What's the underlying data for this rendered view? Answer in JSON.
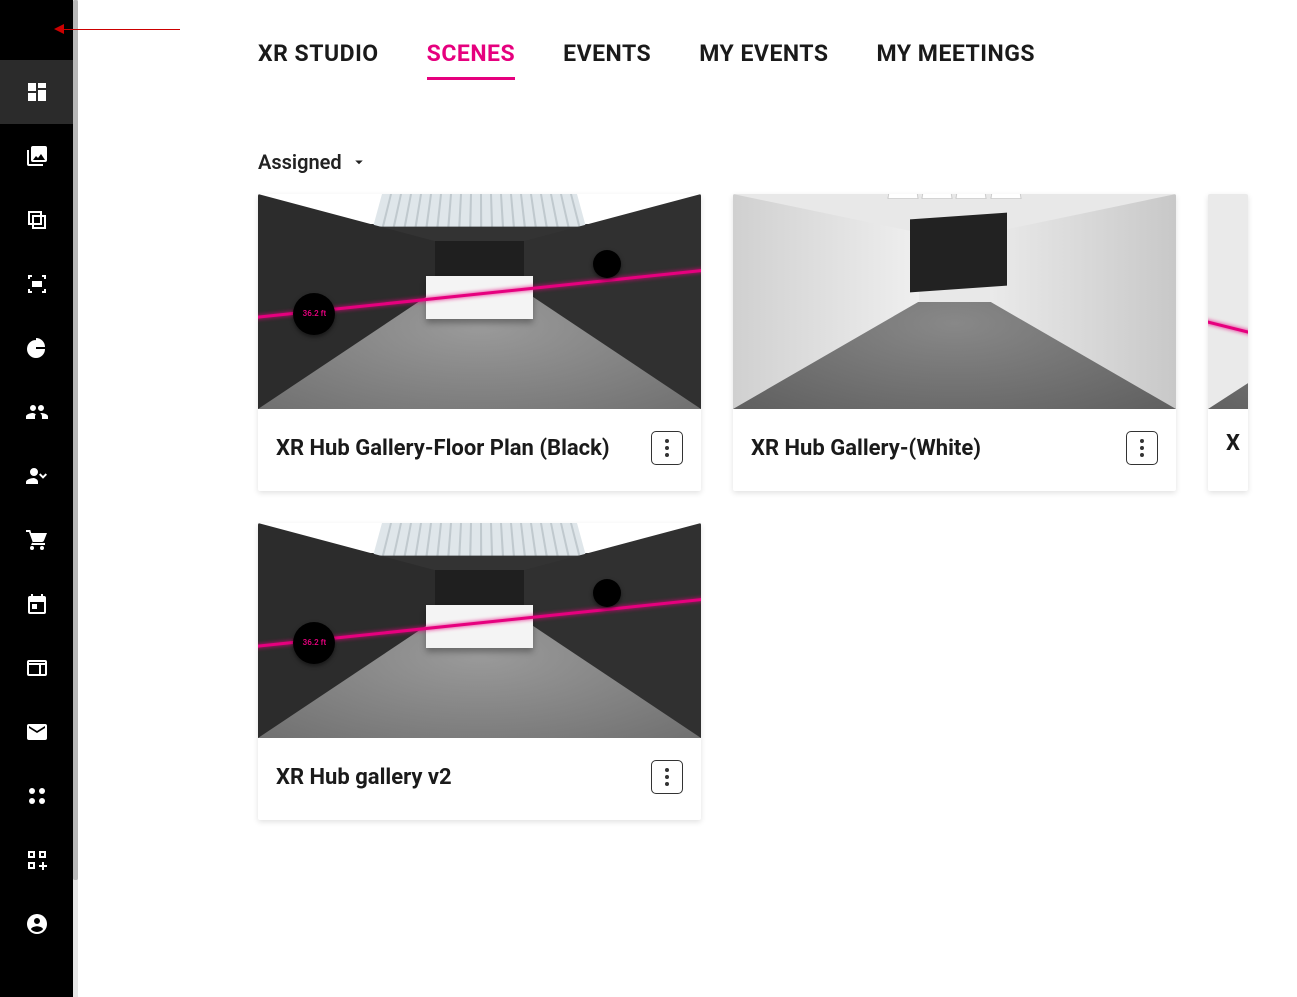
{
  "colors": {
    "accent": "#e6007e"
  },
  "sidebar": {
    "items": [
      {
        "name": "dashboard-icon"
      },
      {
        "name": "images-icon"
      },
      {
        "name": "layers-icon"
      },
      {
        "name": "scan-icon"
      },
      {
        "name": "pie-chart-icon"
      },
      {
        "name": "people-icon"
      },
      {
        "name": "person-check-icon"
      },
      {
        "name": "cart-icon"
      },
      {
        "name": "calendar-icon"
      },
      {
        "name": "web-icon"
      },
      {
        "name": "mail-icon"
      },
      {
        "name": "apps-grid-icon"
      },
      {
        "name": "qr-add-icon"
      },
      {
        "name": "account-icon"
      }
    ]
  },
  "tabs": [
    {
      "label": "XR STUDIO",
      "active": false
    },
    {
      "label": "SCENES",
      "active": true
    },
    {
      "label": "EVENTS",
      "active": false
    },
    {
      "label": "MY EVENTS",
      "active": false
    },
    {
      "label": "MY MEETINGS",
      "active": false
    }
  ],
  "filter": {
    "label": "Assigned"
  },
  "cards": [
    {
      "title": "XR Hub Gallery-Floor Plan (Black)",
      "thumb_label": "36.2 ft"
    },
    {
      "title": "XR Hub Gallery-(White)"
    },
    {
      "title": "X",
      "partial": true
    },
    {
      "title": "XR Hub gallery v2",
      "thumb_label": "36.2 ft"
    }
  ]
}
